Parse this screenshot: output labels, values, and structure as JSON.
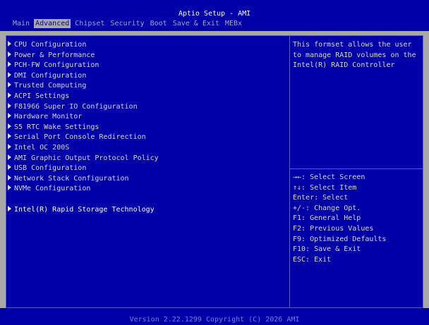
{
  "header": {
    "title": "Aptio Setup - AMI",
    "tabs": [
      {
        "label": "Main",
        "active": false
      },
      {
        "label": "Advanced",
        "active": true
      },
      {
        "label": "Chipset",
        "active": false
      },
      {
        "label": "Security",
        "active": false
      },
      {
        "label": "Boot",
        "active": false
      },
      {
        "label": "Save & Exit",
        "active": false
      },
      {
        "label": "MEBx",
        "active": false
      }
    ]
  },
  "menu": {
    "items": [
      {
        "label": "CPU Configuration"
      },
      {
        "label": "Power & Performance"
      },
      {
        "label": "PCH-FW Configuration"
      },
      {
        "label": "DMI Configuration"
      },
      {
        "label": "Trusted Computing"
      },
      {
        "label": "ACPI Settings"
      },
      {
        "label": "F81966 Super IO Configuration"
      },
      {
        "label": "Hardware Monitor"
      },
      {
        "label": "S5 RTC Wake Settings"
      },
      {
        "label": "Serial Port Console Redirection"
      },
      {
        "label": "Intel OC 200S"
      },
      {
        "label": "AMI Graphic Output Protocol Policy"
      },
      {
        "label": "USB Configuration"
      },
      {
        "label": "Network Stack Configuration"
      },
      {
        "label": "NVMe Configuration"
      },
      {
        "label": "Intel(R) Rapid Storage Technology",
        "selected": true
      }
    ]
  },
  "help": {
    "description": "This formset allows the user to manage RAID volumes on the Intel(R) RAID Controller"
  },
  "keys": [
    "→←: Select Screen",
    "↑↓: Select Item",
    "Enter: Select",
    "+/-: Change Opt.",
    "F1: General Help",
    "F2: Previous Values",
    "F9: Optimized Defaults",
    "F10: Save & Exit",
    "ESC: Exit"
  ],
  "footer": {
    "text": "Version 2.22.1299 Copyright (C) 2026 AMI"
  },
  "colors": {
    "background_blue": "#0000a8",
    "frame_gray": "#a8a8a8",
    "text_light": "#d8d8d8",
    "text_white": "#ffffff",
    "border_blue": "#5a5ad8"
  }
}
